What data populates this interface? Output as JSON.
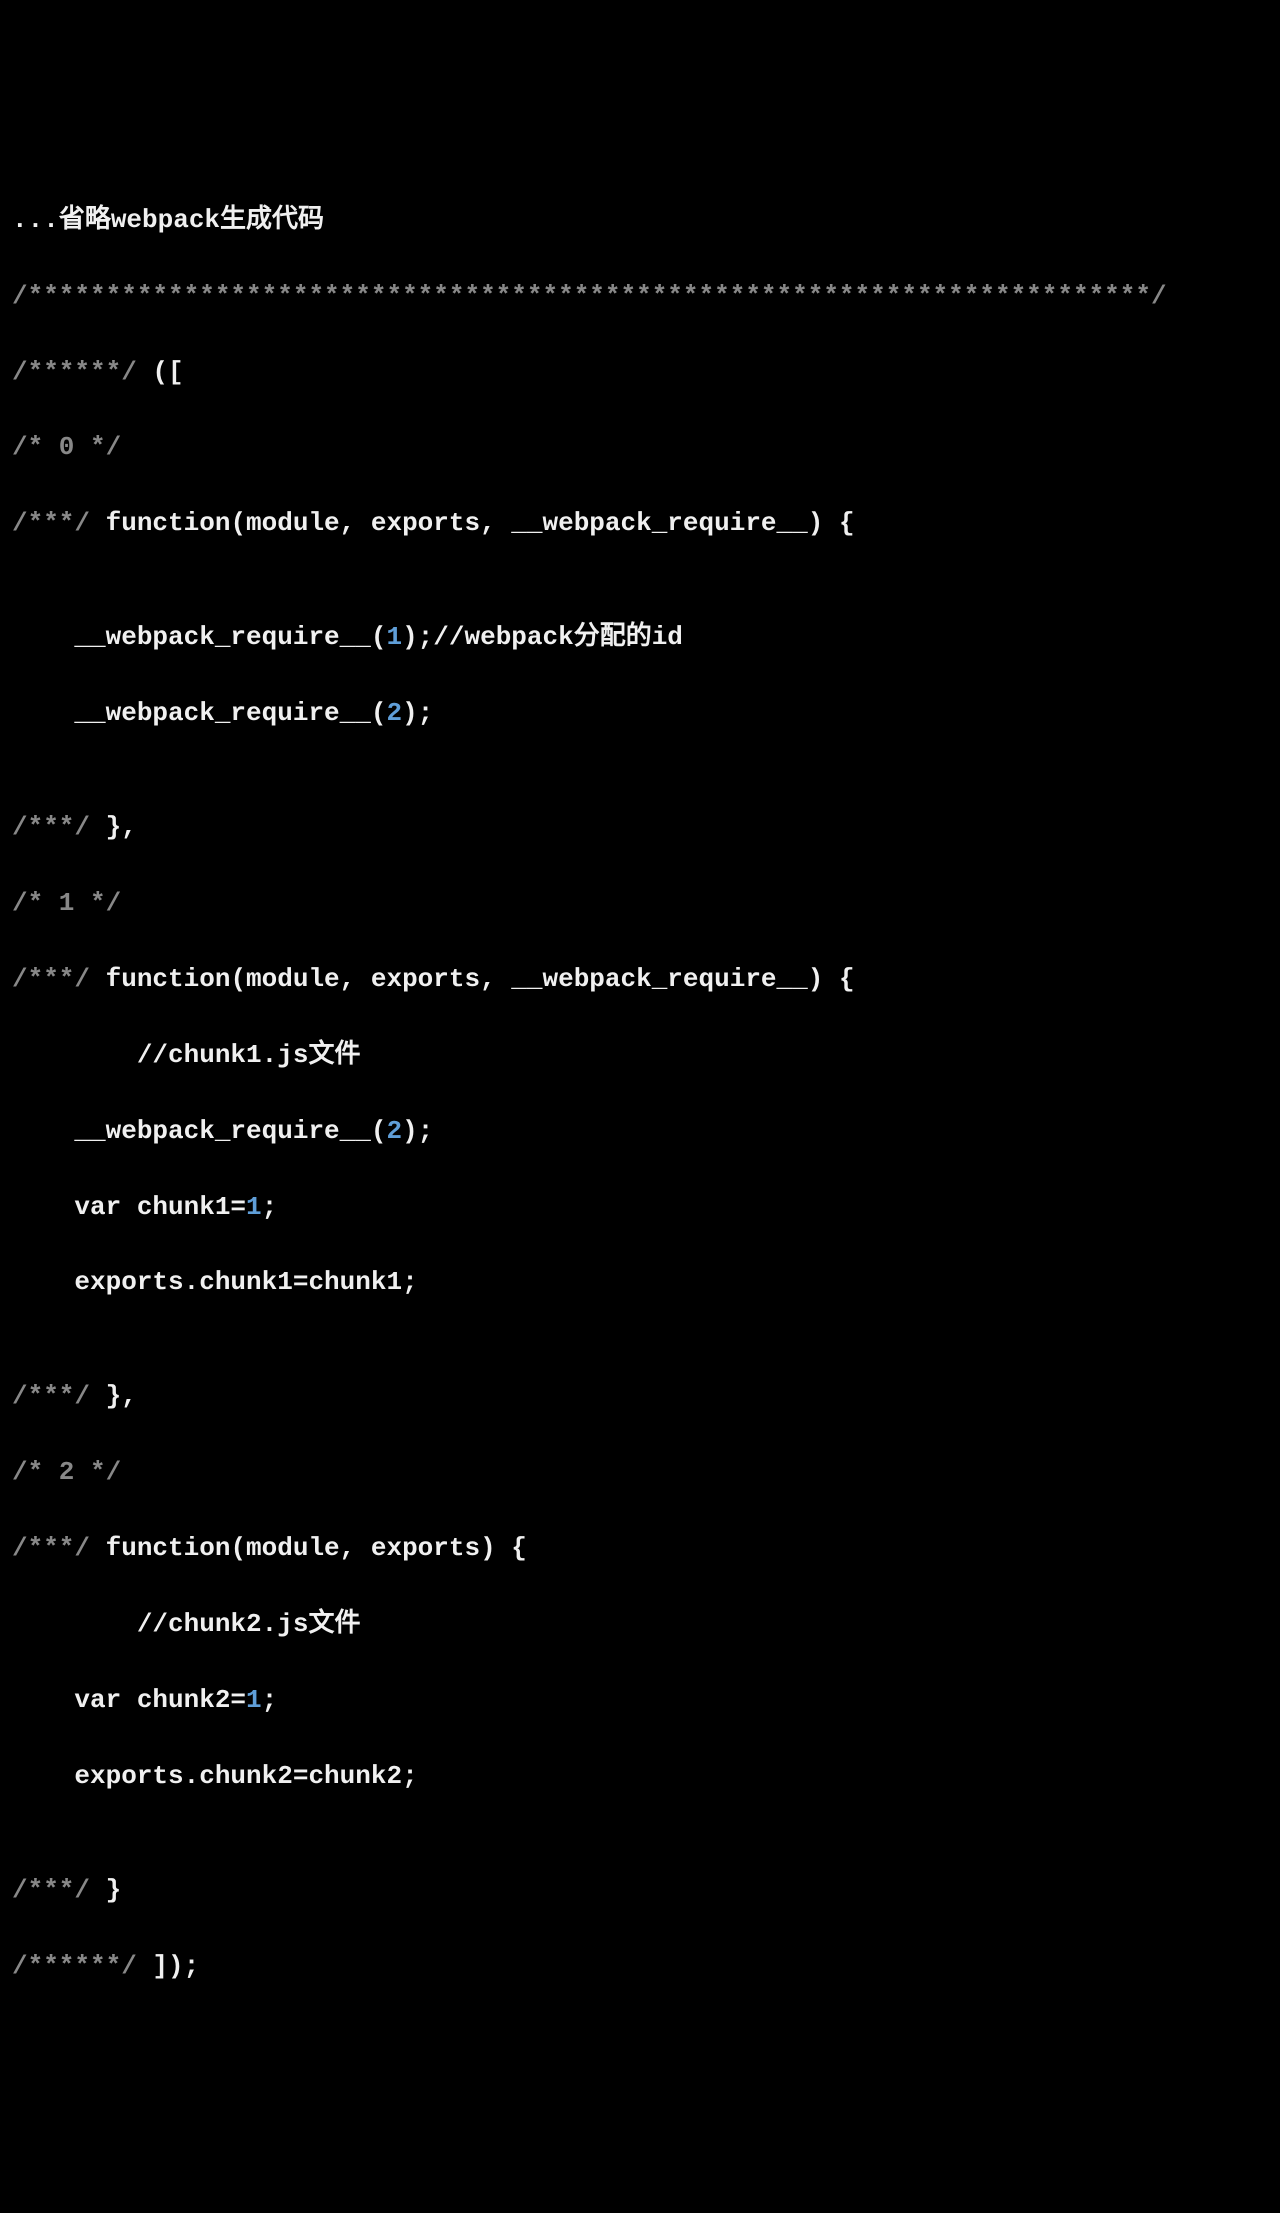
{
  "code": {
    "line1_prefix": "...",
    "line1_title": "省略webpack生成代码",
    "line2": "/************************************************************************/",
    "line3_a": "/******/",
    "line3_b": " ([",
    "line4": "/* 0 */",
    "line5_a": "/***/",
    "line5_b": " function(module, exports, __webpack_require__) {",
    "blank": "",
    "line7_a": "    __webpack_require__(",
    "line7_b": "1",
    "line7_c": ");//webpack分配的id",
    "line8_a": "    __webpack_require__(",
    "line8_b": "2",
    "line8_c": ");",
    "line10_a": "/***/",
    "line10_b": " },",
    "line11": "/* 1 */",
    "line12_a": "/***/",
    "line12_b": " function(module, exports, __webpack_require__) {",
    "line13": "        //chunk1.js文件",
    "line14_a": "    __webpack_require__(",
    "line14_b": "2",
    "line14_c": ");",
    "line15_a": "    var chunk1=",
    "line15_b": "1",
    "line15_c": ";",
    "line16": "    exports.chunk1=chunk1;",
    "line18_a": "/***/",
    "line18_b": " },",
    "line19": "/* 2 */",
    "line20_a": "/***/",
    "line20_b": " function(module, exports) {",
    "line21": "        //chunk2.js文件",
    "line22_a": "    var chunk2=",
    "line22_b": "1",
    "line22_c": ";",
    "line23": "    exports.chunk2=chunk2;",
    "line25_a": "/***/",
    "line25_b": " }",
    "line26_a": "/******/",
    "line26_b": " ]);"
  }
}
